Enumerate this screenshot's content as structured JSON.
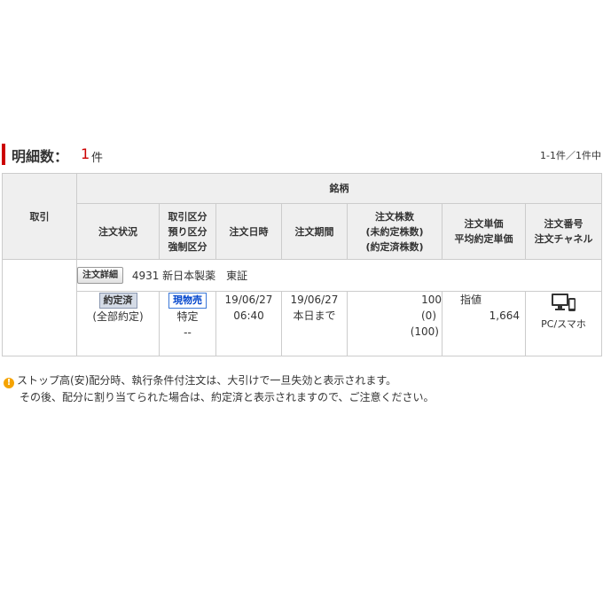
{
  "header": {
    "title_label": "明細数：",
    "count": "1",
    "count_unit": "件",
    "paging": "1-1件／1件中"
  },
  "table": {
    "headers": {
      "torihiki": "取引",
      "meigara": "銘柄",
      "order_status": "注文状況",
      "trade_type_lines": [
        "取引区分",
        "預り区分",
        "強制区分"
      ],
      "order_datetime": "注文日時",
      "order_period": "注文期間",
      "qty_lines": [
        "注文株数",
        "(未約定株数)",
        "(約定済株数)"
      ],
      "price_lines": [
        "注文単価",
        "平均約定単価"
      ],
      "number_lines": [
        "注文番号",
        "注文チャネル"
      ]
    },
    "row": {
      "detail_button": "注文詳細",
      "meigara": "4931 新日本製薬　東証",
      "status_badge": "約定済",
      "status_sub": "(全部約定)",
      "trade_badge": "現物売",
      "account_type": "特定",
      "forced": "--",
      "order_date": "19/06/27",
      "order_time": "06:40",
      "period_date": "19/06/27",
      "period_label": "本日まで",
      "qty": "100",
      "unexecuted": "(0)",
      "executed": "(100)",
      "price_type": "指値",
      "price_value": "1,664",
      "channel": "PC/スマホ"
    }
  },
  "note": {
    "line1": "ストップ高(安)配分時、執行条件付注文は、大引けで一旦失効と表示されます。",
    "line2": "その後、配分に割り当てられた場合は、約定済と表示されますので、ご注意ください。"
  },
  "colors": {
    "accent": "#cc0000",
    "header_bg": "#efefef",
    "border": "#cccccc",
    "sell_blue": "#0044cc",
    "warning": "#f5a300"
  },
  "icons": [
    "pc-smartphone-icon",
    "warning-icon"
  ]
}
